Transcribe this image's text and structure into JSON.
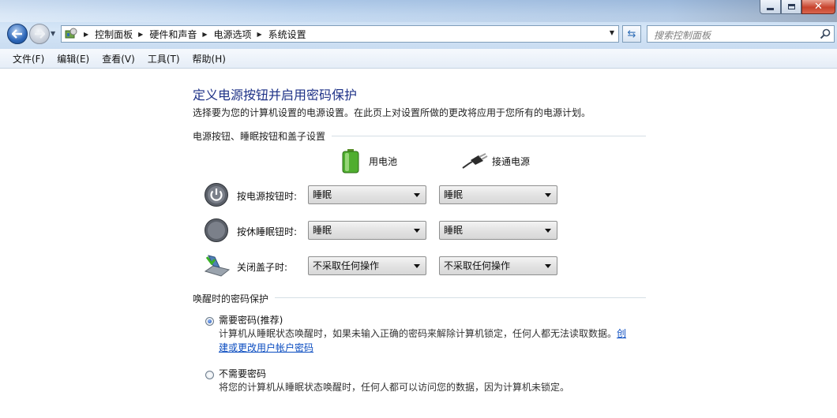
{
  "window": {
    "breadcrumbs": [
      "控制面板",
      "硬件和声音",
      "电源选项",
      "系统设置"
    ],
    "search_placeholder": "搜索控制面板"
  },
  "menu": [
    "文件(F)",
    "编辑(E)",
    "查看(V)",
    "工具(T)",
    "帮助(H)"
  ],
  "page": {
    "title": "定义电源按钮并启用密码保护",
    "description": "选择要为您的计算机设置的电源设置。在此页上对设置所做的更改将应用于您所有的电源计划。"
  },
  "power_section": {
    "heading": "电源按钮、睡眠按钮和盖子设置",
    "columns": {
      "battery": "用电池",
      "plugged_in": "接通电源"
    },
    "rows": [
      {
        "label": "按电源按钮时:",
        "icon": "power-button-icon",
        "battery": "睡眠",
        "plugged_in": "睡眠"
      },
      {
        "label": "按休睡眠钮时:",
        "icon": "sleep-button-icon",
        "battery": "睡眠",
        "plugged_in": "睡眠"
      },
      {
        "label": "关闭盖子时:",
        "icon": "laptop-lid-icon",
        "battery": "不采取任何操作",
        "plugged_in": "不采取任何操作"
      }
    ]
  },
  "password_section": {
    "heading": "唤醒时的密码保护",
    "options": [
      {
        "label": "需要密码(推荐)",
        "checked": true,
        "desc_line1": "计算机从睡眠状态唤醒时，如果未输入正确的密码来解除计算机锁定，任何人都无法读取数据。",
        "link_part1": "创",
        "link_part2": "建或更改用户帐户密码"
      },
      {
        "label": "不需要密码",
        "checked": false,
        "desc_line1": "将您的计算机从睡眠状态唤醒时，任何人都可以访问您的数据，因为计算机未锁定。"
      }
    ]
  },
  "colors": {
    "title": "#1e3287",
    "link": "#0a4cc0",
    "chrome": "#c6dbf2"
  }
}
